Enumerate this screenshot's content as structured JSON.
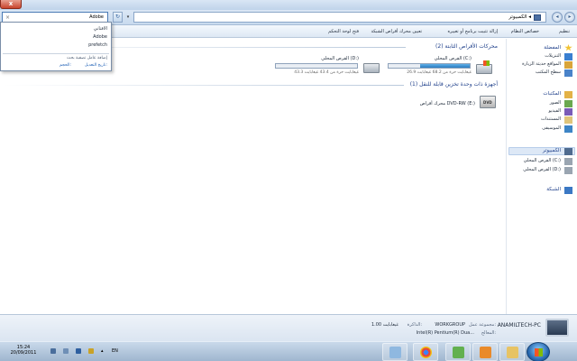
{
  "window": {
    "close_symbol": "x"
  },
  "nav": {
    "search_value": "Adobe",
    "search_clear_symbol": "×",
    "refresh_symbol": "↻",
    "dropdown_symbol": "▾",
    "address": "الكمبيوتر ◂",
    "back_symbol": "◂",
    "forward_symbol": "▸"
  },
  "toolbar": {
    "items": [
      "تنظيم",
      "خصائص النظام",
      "إزالة تثبيت برنامج أو تغييره",
      "تعيين محرك أقراص الشبكة",
      "فتح لوحة التحكم"
    ]
  },
  "autocomplete": {
    "suggestions": [
      "الافتاني",
      "Adobe",
      "prefetch"
    ],
    "hint": "إضافة عامل تصفية بحث",
    "filter_label": "تاريخ التعديل:",
    "filter_value": "الحجم:"
  },
  "content": {
    "hard_disks_header": "محركات الأقراص الثابتة (2)",
    "removable_header": "أجهزة ذات وحدة تخزين قابلة للنقل (1)",
    "drives": [
      {
        "name": "القرص المحلي (C:)",
        "space": "26.9 غيغابايت حرة من 68.2 غيغابايت",
        "used_fraction": 0.61
      },
      {
        "name": "القرص المحلي (D:)",
        "space": "43.3 غيغابايت حرة من 43.4 غيغابايت",
        "used_fraction": 0.0
      }
    ],
    "dvd": {
      "name": "محرك أقراص DVD-RW (E:)"
    }
  },
  "sidebar": {
    "favorites_header": "المفضلة",
    "favorites": [
      "التنزيلات",
      "المواقع حديثة الزيارة",
      "سطح المكتب"
    ],
    "libraries_header": "المكتبات",
    "libraries": [
      "الصور",
      "الفيديو",
      "المستندات",
      "الموسيقى"
    ],
    "computer_header": "الكمبيوتر",
    "computer_items": [
      "القرص المحلي (C:)",
      "القرص المحلي (D:)"
    ],
    "network_header": "الشبكة"
  },
  "details": {
    "pc_name": "ANAMILTECH-PC",
    "workgroup_label": "مجموعة عمل:",
    "workgroup": "WORKGROUP",
    "memory_label": "الذاكرة:",
    "memory": "1.00 غيغابايت",
    "processor_label": "المعالج:",
    "processor": "Intel(R) Pentium(R) Dua..."
  },
  "taskbar": {
    "time": "15:24",
    "date": "20/09/2011",
    "language": "EN"
  },
  "colors": {
    "accent": "#1e3f8a",
    "drive_fill": "#2a7cc0",
    "taskbar": "#9fb6cf"
  }
}
